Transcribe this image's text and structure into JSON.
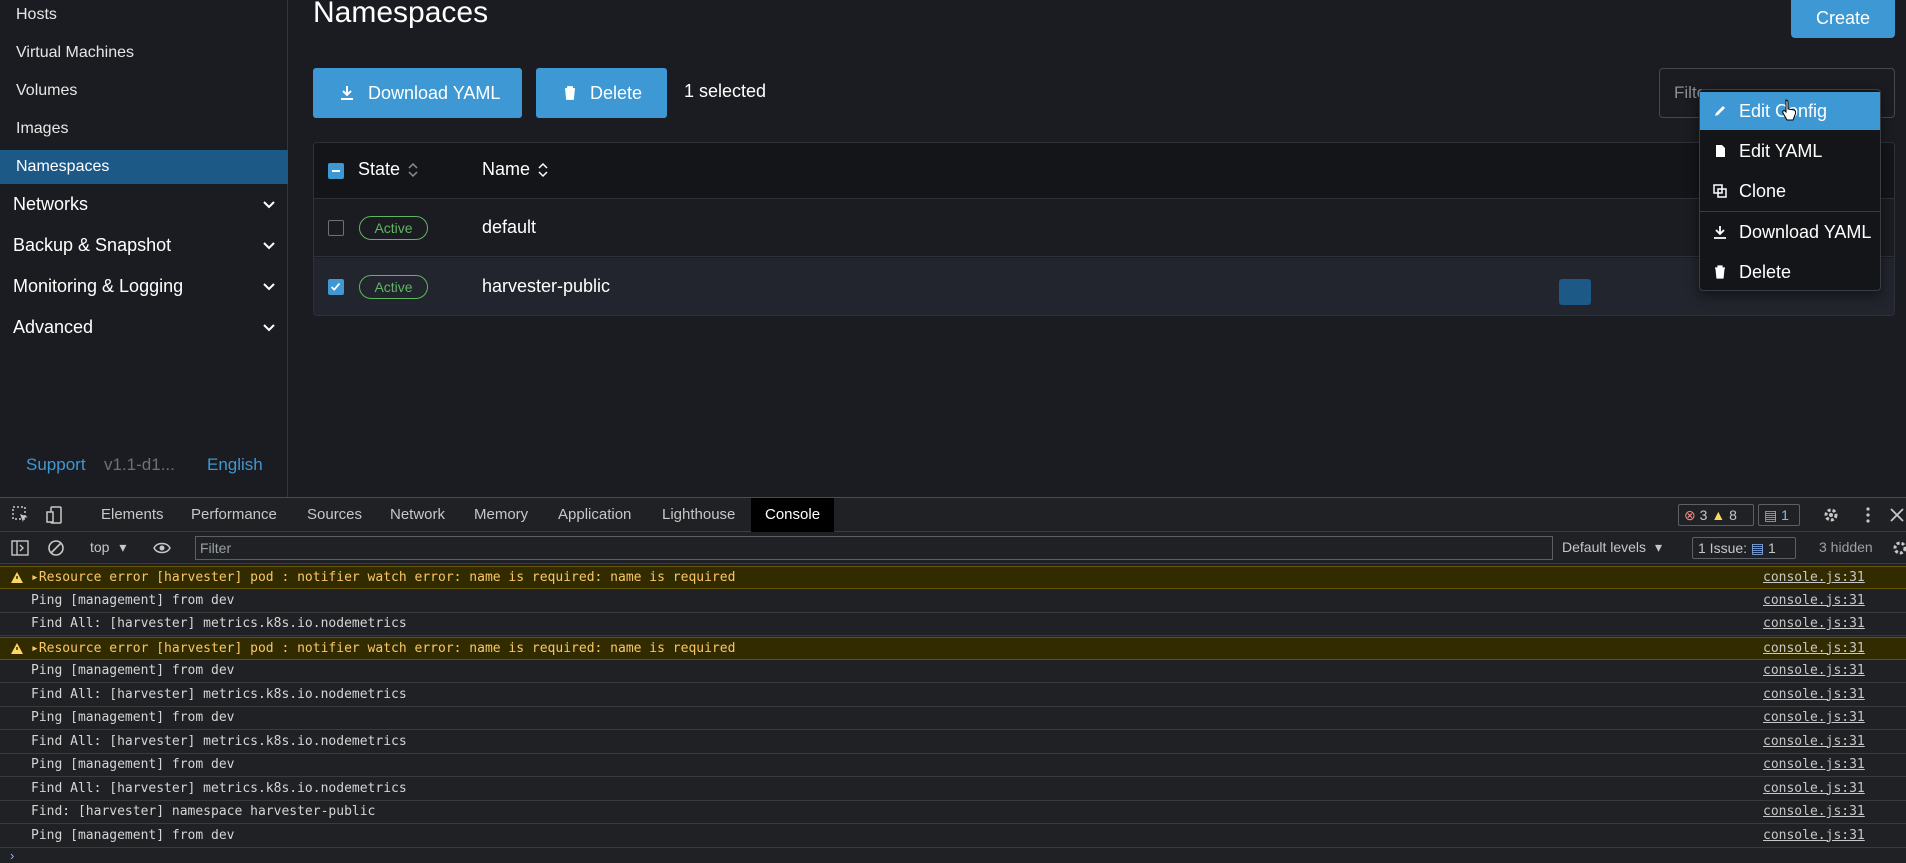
{
  "sidebar": {
    "items": [
      {
        "label": "Hosts"
      },
      {
        "label": "Virtual Machines"
      },
      {
        "label": "Volumes"
      },
      {
        "label": "Images"
      },
      {
        "label": "Namespaces"
      }
    ],
    "groups": [
      {
        "label": "Networks"
      },
      {
        "label": "Backup & Snapshot"
      },
      {
        "label": "Monitoring & Logging"
      },
      {
        "label": "Advanced"
      }
    ],
    "footer": {
      "support": "Support",
      "version": "v1.1-d1...",
      "language": "English"
    }
  },
  "main": {
    "title": "Namespaces",
    "create_label": "Create",
    "download_yaml_label": "Download YAML",
    "delete_label": "Delete",
    "selected_text": "1 selected",
    "filter_placeholder": "Filter"
  },
  "table": {
    "headers": {
      "state": "State",
      "name": "Name"
    },
    "rows": [
      {
        "state": "Active",
        "name": "default",
        "checked": false
      },
      {
        "state": "Active",
        "name": "harvester-public",
        "checked": true
      }
    ]
  },
  "context_menu": {
    "items": [
      {
        "label": "Edit Config",
        "icon": "pencil-icon"
      },
      {
        "label": "Edit YAML",
        "icon": "file-icon"
      },
      {
        "label": "Clone",
        "icon": "copy-icon"
      },
      {
        "label": "Download YAML",
        "icon": "download-icon"
      },
      {
        "label": "Delete",
        "icon": "trash-icon"
      }
    ]
  },
  "devtools": {
    "tabs": [
      "Elements",
      "Performance",
      "Sources",
      "Network",
      "Memory",
      "Application",
      "Lighthouse",
      "Console"
    ],
    "active_tab": "Console",
    "errors": "3",
    "warnings": "8",
    "messages": "1",
    "context": "top",
    "filter_placeholder": "Filter",
    "levels": "Default levels",
    "issues_label": "1 Issue:",
    "issues_count": "1",
    "hidden": "3 hidden",
    "logs": [
      {
        "text": "Resource error [harvester] pod : notifier watch error: name is required: name is required",
        "level": "warn",
        "src": "console.js:31"
      },
      {
        "text": "Ping [management] from dev",
        "level": "info",
        "src": "console.js:31"
      },
      {
        "text": "Find All: [harvester] metrics.k8s.io.nodemetrics",
        "level": "info",
        "src": "console.js:31"
      },
      {
        "text": "Resource error [harvester] pod : notifier watch error: name is required: name is required",
        "level": "warn",
        "src": "console.js:31"
      },
      {
        "text": "Ping [management] from dev",
        "level": "info",
        "src": "console.js:31"
      },
      {
        "text": "Find All: [harvester] metrics.k8s.io.nodemetrics",
        "level": "info",
        "src": "console.js:31"
      },
      {
        "text": "Ping [management] from dev",
        "level": "info",
        "src": "console.js:31"
      },
      {
        "text": "Find All: [harvester] metrics.k8s.io.nodemetrics",
        "level": "info",
        "src": "console.js:31"
      },
      {
        "text": "Ping [management] from dev",
        "level": "info",
        "src": "console.js:31"
      },
      {
        "text": "Find All: [harvester] metrics.k8s.io.nodemetrics",
        "level": "info",
        "src": "console.js:31"
      },
      {
        "text": "Find: [harvester] namespace harvester-public",
        "level": "info",
        "src": "console.js:31"
      },
      {
        "text": "Ping [management] from dev",
        "level": "info",
        "src": "console.js:31"
      }
    ]
  },
  "colors": {
    "accent": "#3d98d3",
    "active_nav": "#1d5986",
    "status_active": "#5fb560",
    "warn_bg": "#332b00"
  }
}
